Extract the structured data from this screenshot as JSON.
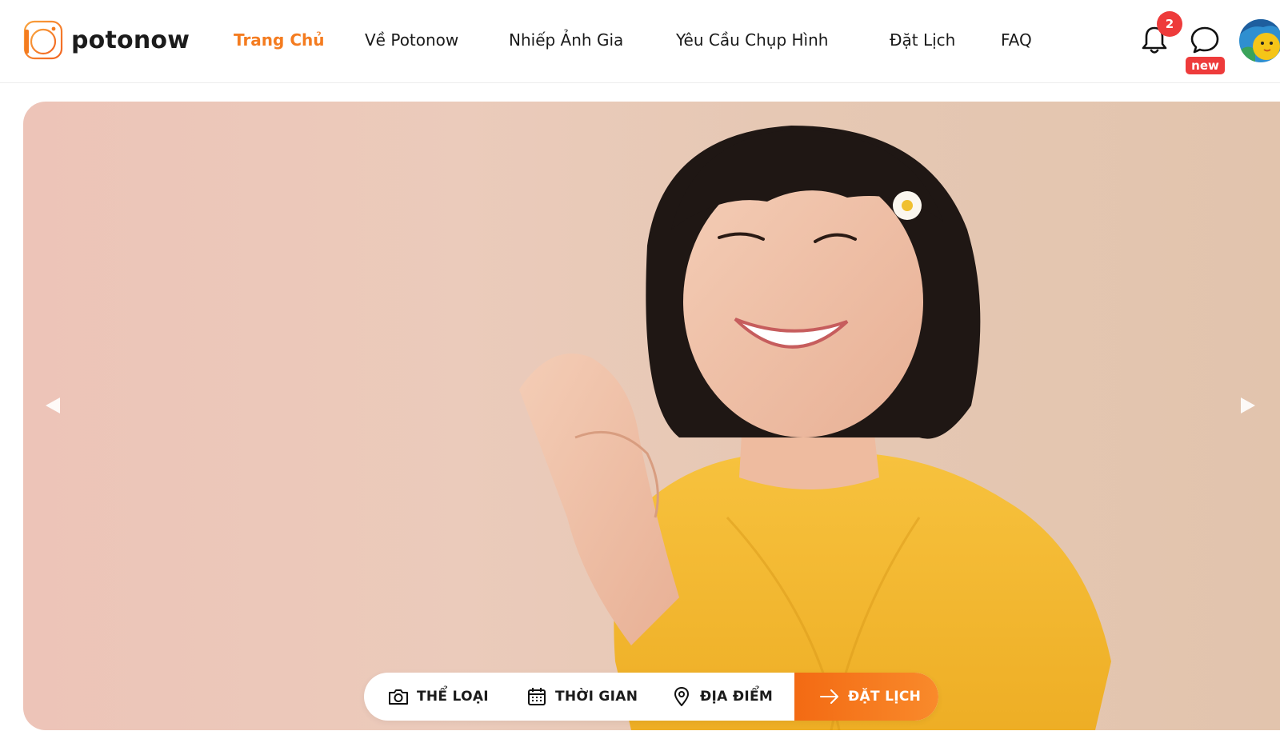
{
  "brand": {
    "name": "potonow",
    "accent": "#f47c20"
  },
  "nav": {
    "items": [
      {
        "label": "Trang Chủ",
        "active": true
      },
      {
        "label": "Về Potonow"
      },
      {
        "label": "Nhiếp Ảnh Gia"
      },
      {
        "label": "Yêu Cầu Chụp Hình"
      },
      {
        "label": "Đặt Lịch"
      },
      {
        "label": "FAQ"
      }
    ]
  },
  "header_actions": {
    "notifications": {
      "icon": "bell-icon",
      "count": "2"
    },
    "messages": {
      "icon": "chat-bubble-icon",
      "badge": "new"
    },
    "avatar": {
      "icon": "avatar"
    }
  },
  "hero": {
    "prev_icon": "chevron-left-icon",
    "next_icon": "chevron-right-icon"
  },
  "booking": {
    "category": {
      "icon": "camera-icon",
      "label": "THỂ LOẠI"
    },
    "time": {
      "icon": "calendar-icon",
      "label": "THỜI GIAN"
    },
    "location": {
      "icon": "map-pin-icon",
      "label": "ĐỊA ĐIỂM"
    },
    "cta": {
      "icon": "arrow-right-icon",
      "label": "ĐẶT LỊCH"
    }
  },
  "colors": {
    "badge_red": "#ee3b3b",
    "cta_orange": "#f36a13",
    "hero_bg": "#ebcbbb"
  }
}
